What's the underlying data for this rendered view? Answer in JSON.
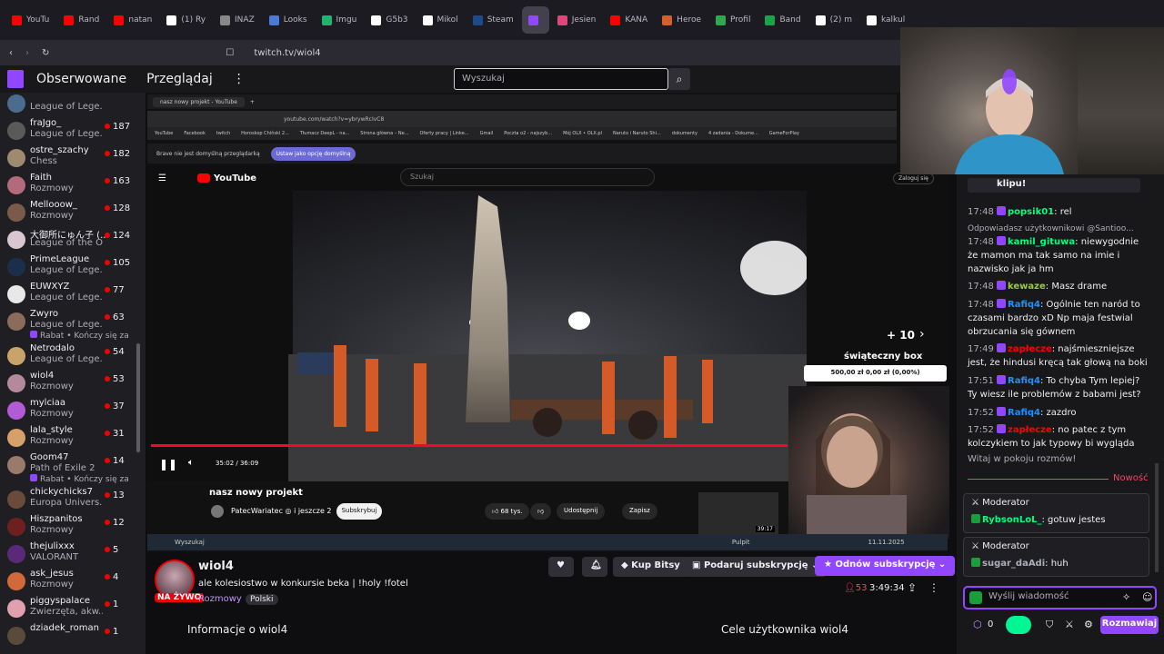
{
  "browser": {
    "tabs": [
      {
        "label": "YouTu",
        "color": "#ff0000"
      },
      {
        "label": "Rand",
        "color": "#ff0000"
      },
      {
        "label": "natan",
        "color": "#ff0000"
      },
      {
        "label": "(1) Ry",
        "color": "#ffffff"
      },
      {
        "label": "INAZ",
        "color": "#888888"
      },
      {
        "label": "Looks",
        "color": "#4a7bd6"
      },
      {
        "label": "Imgu",
        "color": "#1bb76e"
      },
      {
        "label": "G5b3",
        "color": "#ffffff"
      },
      {
        "label": "Mikol",
        "color": "#ffffff"
      },
      {
        "label": "Steam",
        "color": "#1b4b8a"
      },
      {
        "label": "",
        "color": "#9147ff"
      },
      {
        "label": "Jesien",
        "color": "#e0457b"
      },
      {
        "label": "KANA",
        "color": "#ff0000"
      },
      {
        "label": "Heroe",
        "color": "#d6602b"
      },
      {
        "label": "Profil",
        "color": "#2fa84f"
      },
      {
        "label": "Band",
        "color": "#1aa34a"
      },
      {
        "label": "(2) m",
        "color": "#ffffff"
      },
      {
        "label": "kalkul",
        "color": "#ffffff"
      }
    ],
    "url": "twitch.tv/wiol4"
  },
  "twitch": {
    "nav": [
      "Obserwowane",
      "Przeglądaj"
    ],
    "search_placeholder": "Wyszukaj"
  },
  "sidebar": [
    {
      "name": "",
      "game": "League of Lege...",
      "viewers": "",
      "color": "#4b6c8f",
      "sub": ""
    },
    {
      "name": "fraJgo_",
      "game": "League of Lege...",
      "viewers": "187",
      "color": "#5a5a5a",
      "sub": ""
    },
    {
      "name": "ostre_szachy",
      "game": "Chess",
      "viewers": "182",
      "color": "#9e8a6e",
      "sub": ""
    },
    {
      "name": "Faith",
      "game": "Rozmowy",
      "viewers": "163",
      "color": "#b36a7d",
      "sub": ""
    },
    {
      "name": "Mellooow_",
      "game": "Rozmowy",
      "viewers": "128",
      "color": "#7a5a4a",
      "sub": ""
    },
    {
      "name": "大御所にゅん子 (...",
      "game": "League of the O...",
      "viewers": "124",
      "color": "#d9c7d0",
      "sub": ""
    },
    {
      "name": "PrimeLeague",
      "game": "League of Lege...",
      "viewers": "105",
      "color": "#1c2f4a",
      "sub": ""
    },
    {
      "name": "EUWXYZ",
      "game": "League of Lege...",
      "viewers": "77",
      "color": "#e8e8e8",
      "sub": ""
    },
    {
      "name": "Zwyro",
      "game": "League of Lege...",
      "viewers": "63",
      "color": "#8a6c5a",
      "sub": "Rabat • Kończy się za"
    },
    {
      "name": "Netrodalo",
      "game": "League of Lege...",
      "viewers": "54",
      "color": "#c9a36a",
      "sub": ""
    },
    {
      "name": "wiol4",
      "game": "Rozmowy",
      "viewers": "53",
      "color": "#b48a9a",
      "sub": ""
    },
    {
      "name": "mylciaa",
      "game": "Rozmowy",
      "viewers": "37",
      "color": "#b35ad6",
      "sub": ""
    },
    {
      "name": "lala_style",
      "game": "Rozmowy",
      "viewers": "31",
      "color": "#d6a06a",
      "sub": ""
    },
    {
      "name": "Goom47",
      "game": "Path of Exile 2",
      "viewers": "14",
      "color": "#9a7a6a",
      "sub": "Rabat • Kończy się za"
    },
    {
      "name": "chickychicks7",
      "game": "Europa Univers...",
      "viewers": "13",
      "color": "#6a4a3a",
      "sub": ""
    },
    {
      "name": "Hiszpanitos",
      "game": "Rozmowy",
      "viewers": "12",
      "color": "#6e2020",
      "sub": ""
    },
    {
      "name": "thejulixxx",
      "game": "VALORANT",
      "viewers": "5",
      "color": "#5a2a7a",
      "sub": ""
    },
    {
      "name": "ask_jesus",
      "game": "Rozmowy",
      "viewers": "4",
      "color": "#d06a3a",
      "sub": ""
    },
    {
      "name": "piggyspalace",
      "game": "Zwierzęta, akw...",
      "viewers": "1",
      "color": "#e0a0b0",
      "sub": ""
    },
    {
      "name": "dziadek_roman",
      "game": "",
      "viewers": "1",
      "color": "#5a4a3a",
      "sub": ""
    }
  ],
  "stream_content": {
    "nested_tab": "nasz nowy projekt - YouTube",
    "nested_url": "youtube.com/watch?v=ybrywRcIvC8",
    "bookmarks": [
      "YouTube",
      "Facebook",
      "twitch",
      "Horoskop Chiński 2...",
      "Tłumacz DeepL - na...",
      "Strona główna – Ne...",
      "Oferty pracy | Linke...",
      "Gmail",
      "Poczta o2 - najszyb...",
      "Mój OLX • OLX.pl",
      "Naruto i Naruto Shi...",
      "dokumenty",
      "4 zadania - Dokume...",
      "GameForPlay"
    ],
    "brave_notice": "Brave nie jest domyślną przeglądarką",
    "brave_button": "Ustaw jako opcję domyślną",
    "yt_logo": "YouTube",
    "yt_search": "Szukaj",
    "yt_login": "Zaloguj się",
    "video_time": "35:02 / 36:09",
    "video_title": "nasz nowy projekt",
    "channel": "PatecWariatec ◎ i jeszcze 2",
    "subscribe": "Subskrybuj",
    "likes": "68 tys.",
    "share": "Udostępnij",
    "save": "Zapisz",
    "skip": "+ 10",
    "box_title": "świąteczny box",
    "box_value": "500,00 zł   0,00 zł (0,00%)",
    "thumb_duration": "39:17",
    "taskbar_search": "Wyszukaj",
    "taskbar_desktop": "Pulpit",
    "taskbar_date": "11.11.2025"
  },
  "chat": {
    "top_fragment": "klipu!",
    "messages": [
      {
        "time": "17:48",
        "user": "popsik01",
        "text": ": rel",
        "color": "#00ff7f"
      },
      {
        "time": "",
        "user": "",
        "text": "Odpowiadasz użytkownikowi @Santioo...",
        "color": "#adadb8"
      },
      {
        "time": "17:48",
        "user": "kamil_gituwa",
        "text": ": niewygodnie że mamon ma tak samo na imie i nazwisko jak ja hm",
        "color": "#00ff7f"
      },
      {
        "time": "17:48",
        "user": "kewaze",
        "text": ": Masz drame",
        "color": "#9acd32"
      },
      {
        "time": "17:48",
        "user": "Rafiq4",
        "text": ": Ogólnie ten naród to czasami bardzo xD Np maja festwial obrzucania się gównem",
        "color": "#1e90ff"
      },
      {
        "time": "17:49",
        "user": "zapłecze",
        "text": ": najśmieszniejsze jest, że hindusi kręcą tak głową na boki",
        "color": "#ff0000"
      },
      {
        "time": "17:51",
        "user": "Rafiq4",
        "text": ": To chyba Tym lepiej? Ty wiesz ile problemów z babami jest?",
        "color": "#1e90ff"
      },
      {
        "time": "17:52",
        "user": "Rafiq4",
        "text": ": zazdro",
        "color": "#1e90ff"
      },
      {
        "time": "17:52",
        "user": "zapłecze",
        "text": ": no patec z tym kolczykiem to jak typowy bi wygląda",
        "color": "#ff0000"
      }
    ],
    "welcome": "Witaj w pokoju rozmów!",
    "new_label": "Nowość",
    "mod_cards": [
      {
        "title": "Moderator",
        "user": "RybsonLoL_",
        "text": ": gotuw jestes",
        "color": "#00ff7f"
      },
      {
        "title": "Moderator",
        "user": "sugar_daAdi",
        "text": ": huh",
        "color": "#adadb8"
      }
    ],
    "input_placeholder": "Wyślij wiadomość",
    "points": "0",
    "send": "Rozmawiaj"
  },
  "channel_info": {
    "name": "wiol4",
    "live": "NA ŻYWO",
    "title": "ale kolesiostwo w konkursie beka | !holy !fotel",
    "category": "Rozmowy",
    "language": "Polski",
    "bits": "Kup Bitsy",
    "gift": "Podaruj subskrypcję",
    "renew": "Odnów subskrypcję",
    "viewers": "53",
    "uptime": "3:49:34",
    "info_heading": "Informacje o wiol4",
    "goals_heading": "Cele użytkownika wiol4"
  }
}
